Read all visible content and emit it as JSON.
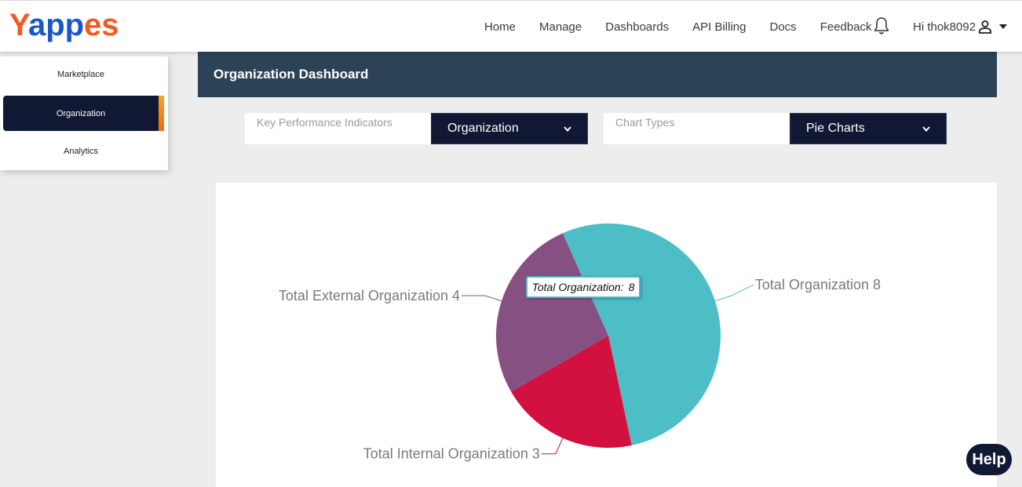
{
  "brand": {
    "logo_text": "Yappes",
    "colors": {
      "primary": "#1b57c9",
      "accent": "#f15a24"
    }
  },
  "nav": {
    "links": [
      "Home",
      "Manage",
      "Dashboards",
      "API Billing",
      "Docs",
      "Feedback"
    ],
    "notification_icon": "bell-icon",
    "user_greeting": "Hi thok8092",
    "user_icon": "user-icon"
  },
  "sidebar": {
    "items": [
      {
        "label": "Marketplace",
        "active": false
      },
      {
        "label": "Organization",
        "active": true
      },
      {
        "label": "Analytics",
        "active": false
      }
    ]
  },
  "header": {
    "title": "Organization Dashboard"
  },
  "filters": {
    "kpi": {
      "label": "Key Performance Indicators",
      "selected": "Organization"
    },
    "chart_type": {
      "label": "Chart Types",
      "selected": "Pie Charts"
    }
  },
  "chart_data": {
    "type": "pie",
    "slices": [
      {
        "name": "Total Organization",
        "value": 8,
        "label": "Total Organization 8",
        "color": "#4dbdc6"
      },
      {
        "name": "Total Internal Organization",
        "value": 3,
        "label": "Total Internal Organization 3",
        "color": "#d21140"
      },
      {
        "name": "Total External Organization",
        "value": 4,
        "label": "Total External Organization 4",
        "color": "#875083"
      }
    ],
    "tooltip": {
      "label": "Total Organization:",
      "value": "8"
    }
  },
  "help_button": {
    "label": "Help"
  }
}
